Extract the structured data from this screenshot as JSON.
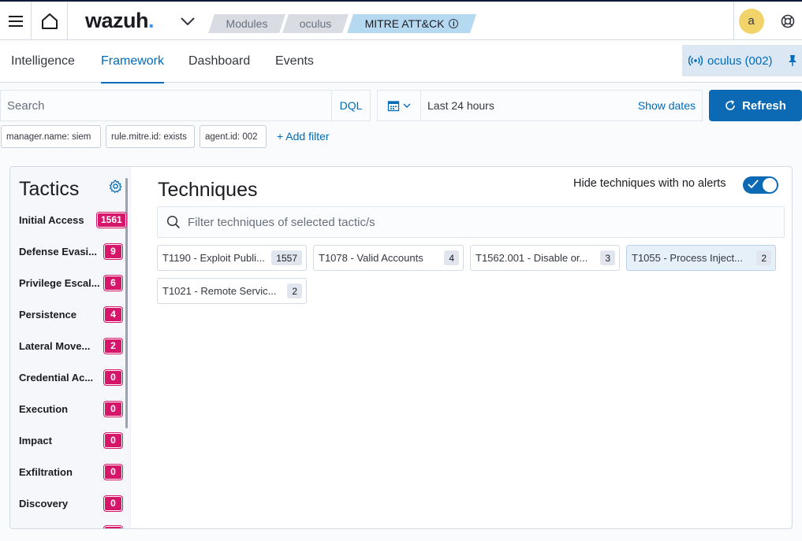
{
  "header": {
    "logo_text": "wazuh",
    "logo_dot": ".",
    "breadcrumbs": [
      "Modules",
      "oculus",
      "MITRE ATT&CK"
    ],
    "avatar_initial": "a"
  },
  "tabs": [
    "Intelligence",
    "Framework",
    "Dashboard",
    "Events"
  ],
  "agent": {
    "label": "oculus (002)"
  },
  "search": {
    "placeholder": "Search",
    "language": "DQL"
  },
  "date": {
    "label": "Last 24 hours",
    "show_dates": "Show dates",
    "refresh": "Refresh"
  },
  "filters": [
    "manager.name: siem",
    "rule.mitre.id: exists",
    "agent.id: 002"
  ],
  "add_filter": "+ Add filter",
  "tactics_panel": {
    "title": "Tactics",
    "items": [
      {
        "label": "Initial Access",
        "count": "1561"
      },
      {
        "label": "Defense Evasi...",
        "count": "9"
      },
      {
        "label": "Privilege Escal...",
        "count": "6"
      },
      {
        "label": "Persistence",
        "count": "4"
      },
      {
        "label": "Lateral Move...",
        "count": "2"
      },
      {
        "label": "Credential Ac...",
        "count": "0"
      },
      {
        "label": "Execution",
        "count": "0"
      },
      {
        "label": "Impact",
        "count": "0"
      },
      {
        "label": "Exfiltration",
        "count": "0"
      },
      {
        "label": "Discovery",
        "count": "0"
      }
    ]
  },
  "techniques_panel": {
    "title": "Techniques",
    "hide_label": "Hide techniques with no alerts",
    "hide_enabled": true,
    "filter_placeholder": "Filter techniques of selected tactic/s",
    "items": [
      {
        "label": "T1190 - Exploit Publi...",
        "count": "1557"
      },
      {
        "label": "T1078 - Valid Accounts",
        "count": "4"
      },
      {
        "label": "T1562.001 - Disable or...",
        "count": "3"
      },
      {
        "label": "T1055 - Process Inject...",
        "count": "2"
      },
      {
        "label": "T1021 - Remote Servic...",
        "count": "2"
      }
    ]
  },
  "colors": {
    "accent": "#006bb8",
    "badge": "#d6166b",
    "refresh": "#0b6ab3"
  }
}
